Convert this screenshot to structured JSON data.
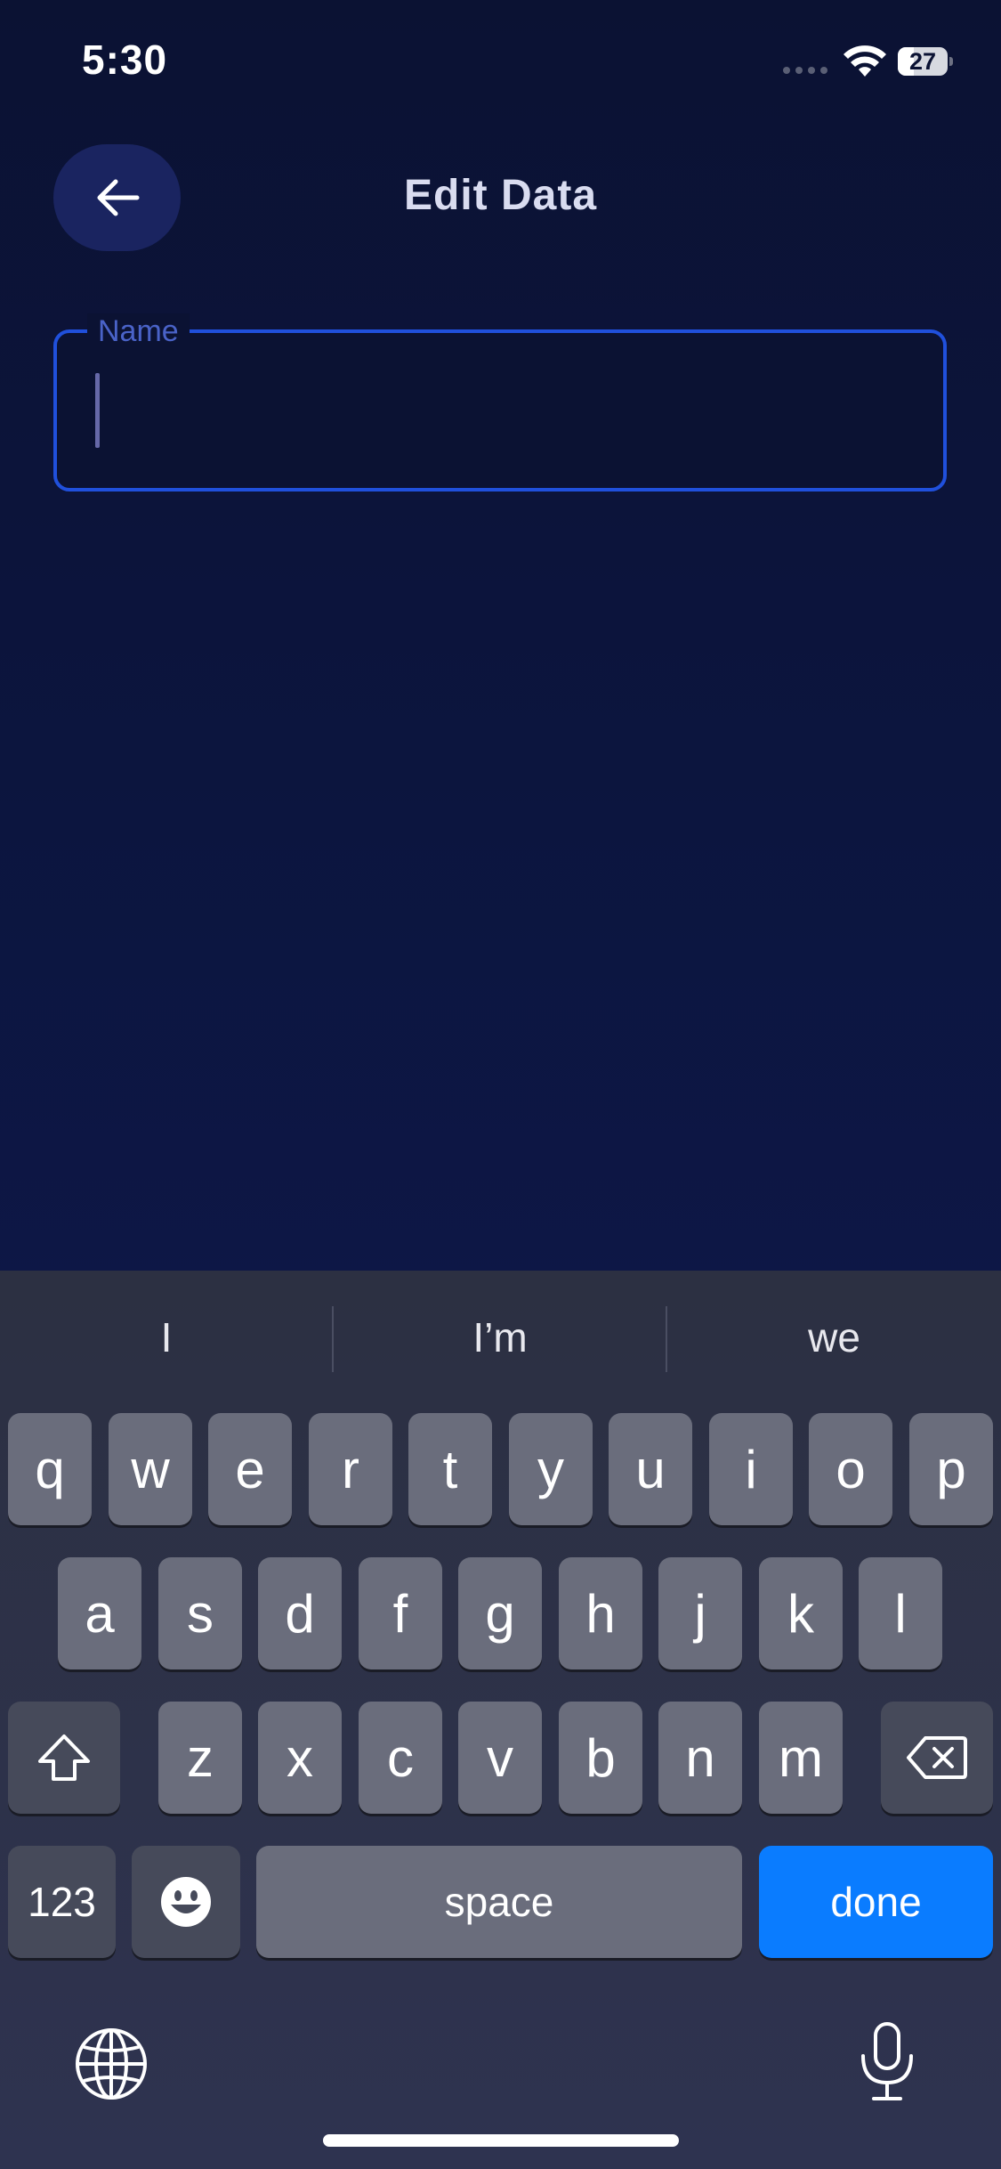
{
  "status_bar": {
    "time": "5:30",
    "battery_level": "27"
  },
  "header": {
    "title": "Edit Data",
    "back_icon": "arrow-left-icon"
  },
  "form": {
    "name_label": "Name",
    "name_value": "",
    "name_placeholder": ""
  },
  "keyboard": {
    "suggestions": [
      "I",
      "I’m",
      "we"
    ],
    "row1": [
      "q",
      "w",
      "e",
      "r",
      "t",
      "y",
      "u",
      "i",
      "o",
      "p"
    ],
    "row2": [
      "a",
      "s",
      "d",
      "f",
      "g",
      "h",
      "j",
      "k",
      "l"
    ],
    "row3": [
      "z",
      "x",
      "c",
      "v",
      "b",
      "n",
      "m"
    ],
    "numbers_label": "123",
    "space_label": "space",
    "done_label": "done"
  },
  "colors": {
    "accent": "#0a7cff",
    "field_border": "#2050dc",
    "background": "#0b1233"
  }
}
